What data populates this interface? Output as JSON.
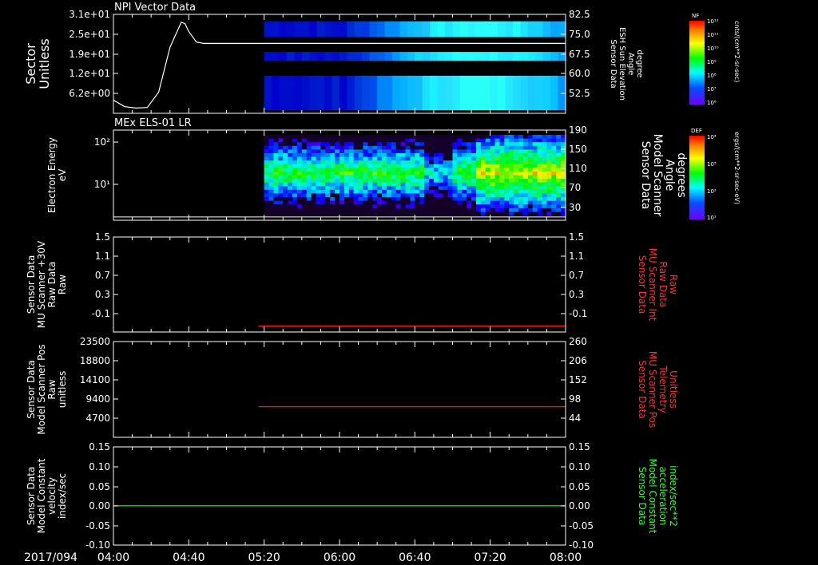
{
  "colors": {
    "background": "#000000",
    "axis": "#ffffff",
    "red_series": "#ff2020",
    "green_series": "#20ff20",
    "right_label_red": "#ff3030",
    "right_label_green": "#30ff30"
  },
  "x_axis": {
    "date": "2017/094",
    "ticks": [
      "04:00",
      "04:40",
      "05:20",
      "06:00",
      "06:40",
      "07:20",
      "08:00"
    ],
    "range": [
      "04:00",
      "08:00"
    ]
  },
  "chart_data": [
    {
      "type": "heatmap",
      "title": "NPI Vector Data",
      "ylabel_left": [
        "Sector",
        "Unitless"
      ],
      "yticks_left": [
        "3.1e+01",
        "2.5e+01",
        "1.9e+01",
        "1.2e+01",
        "6.2e+00"
      ],
      "ylabel_right": [
        "Sensor Data",
        "ESH Sun Elevation",
        "Angle",
        "degree"
      ],
      "yticks_right": [
        "82.5",
        "75.0",
        "67.5",
        "60.0",
        "52.5"
      ],
      "y_right_range": [
        45.0,
        82.5
      ],
      "data_start": "05:20",
      "series": [
        {
          "type": "line",
          "axis": "right",
          "x": [
            "04:00",
            "04:06",
            "04:12",
            "04:18",
            "04:24",
            "04:30",
            "04:36",
            "04:38",
            "04:40",
            "04:44",
            "04:48",
            "04:52",
            "08:00"
          ],
          "values": [
            50.0,
            47.5,
            47.0,
            47.2,
            53.0,
            70.0,
            79.5,
            79.0,
            76.0,
            72.0,
            71.5,
            71.5,
            71.5
          ]
        }
      ],
      "colorbar": {
        "label": "NF",
        "units": "cnts/(cm**2-sr-sec)",
        "ticks": [
          "10¹²",
          "10¹¹",
          "10¹⁰",
          "10⁹",
          "10⁸",
          "10⁷",
          "10⁶"
        ]
      }
    },
    {
      "type": "heatmap",
      "title": "MEx ELS-01 LR",
      "ylabel_left": [
        "Electron Energy",
        "eV"
      ],
      "yticks_left": [
        "10²",
        "10¹"
      ],
      "y_log_range": [
        0,
        2.3
      ],
      "ylabel_right": [
        "Sensor Data",
        "Model Scanner",
        "Angle",
        "degrees"
      ],
      "yticks_right": [
        "190",
        "150",
        "110",
        "70",
        "30"
      ],
      "y_right_range": [
        0,
        190
      ],
      "data_start": "05:20",
      "series": [
        {
          "type": "line",
          "axis": "right",
          "x": [
            "04:00",
            "08:00"
          ],
          "values": [
            7,
            7
          ]
        }
      ],
      "colorbar": {
        "label": "DEF",
        "units": "ergs/(cm**2-sr-sec-eV)",
        "ticks": [
          "10⁴",
          "10³",
          "10²",
          "10¹"
        ]
      }
    },
    {
      "type": "line",
      "ylabel_left": [
        "Sensor Data",
        "MU Scanner +30V",
        "Raw Data",
        "Raw"
      ],
      "yticks_left": [
        "1.5",
        "1.1",
        "0.7",
        "0.3",
        "-0.1"
      ],
      "ylim": [
        -0.1,
        1.5
      ],
      "ylabel_right": [
        "Sensor Data",
        "MU Scanner Int",
        "Raw Data",
        "Raw"
      ],
      "yticks_right": [
        "1.5",
        "1.1",
        "0.7",
        "0.3",
        "-0.1"
      ],
      "series": [
        {
          "color": "#ff2020",
          "x": [
            "05:17",
            "08:00"
          ],
          "values": [
            0.0,
            0.0
          ]
        }
      ]
    },
    {
      "type": "line",
      "ylabel_left": [
        "Sensor Data",
        "Model Scanner Pos",
        "Raw",
        "unitless"
      ],
      "yticks_left": [
        "23500",
        "18800",
        "14100",
        "9400",
        "4700"
      ],
      "ylim": [
        0,
        23500
      ],
      "ylabel_right": [
        "Sensor Data",
        "MU Scanner Pos",
        "Telemetry",
        "Unitless"
      ],
      "yticks_right": [
        "260",
        "206",
        "152",
        "98",
        "44"
      ],
      "series": [
        {
          "color": "#ff2020",
          "x": [
            "05:17",
            "08:00"
          ],
          "values": [
            7500,
            7500
          ]
        }
      ]
    },
    {
      "type": "line",
      "ylabel_left": [
        "Sensor Data",
        "Model Constant",
        "velocity",
        "index/sec"
      ],
      "yticks_left": [
        "0.15",
        "0.10",
        "0.05",
        "0.00",
        "-0.05",
        "-0.10"
      ],
      "ylim": [
        -0.1,
        0.15
      ],
      "ylabel_right": [
        "Sensor Data",
        "Model Constant",
        "acceleration",
        "index/sec**2"
      ],
      "yticks_right": [
        "0.15",
        "0.10",
        "0.05",
        "0.00",
        "-0.05",
        "-0.10"
      ],
      "series": [
        {
          "color": "#20ff20",
          "x": [
            "04:00",
            "08:00"
          ],
          "values": [
            0.0,
            0.0
          ]
        }
      ]
    }
  ]
}
